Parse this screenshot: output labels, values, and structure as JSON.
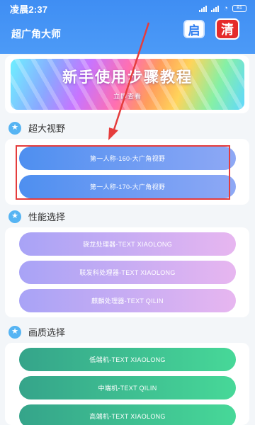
{
  "status_bar": {
    "time": "凌晨2:37",
    "battery": "81"
  },
  "header": {
    "title": "超广角大师",
    "start_badge": "启",
    "clean_badge": "清"
  },
  "banner": {
    "title": "新手使用步骤教程",
    "subtitle": "立即查看"
  },
  "sections": {
    "view": {
      "title": "超大视野",
      "icon": "star-icon",
      "buttons": [
        "第一人称-160-大广角视野",
        "第一人称-170-大广角视野"
      ]
    },
    "performance": {
      "title": "性能选择",
      "icon": "star-icon",
      "buttons": [
        "骁龙处理器-TEXT XIAOLONG",
        "联发科处理器-TEXT XIAOLONG",
        "麒麟处理器-TEXT QILIN"
      ]
    },
    "quality": {
      "title": "画质选择",
      "icon": "star-icon",
      "buttons": [
        "低端机-TEXT XIAOLONG",
        "中端机-TEXT QILIN",
        "高端机-TEXT XIAOLONG"
      ]
    }
  },
  "colors": {
    "header": "#4393f5",
    "accent_red": "#e53c3c",
    "blue_button": "#4e8ff0",
    "purple_button": "#a8a3f6",
    "green_button": "#35a48a"
  }
}
